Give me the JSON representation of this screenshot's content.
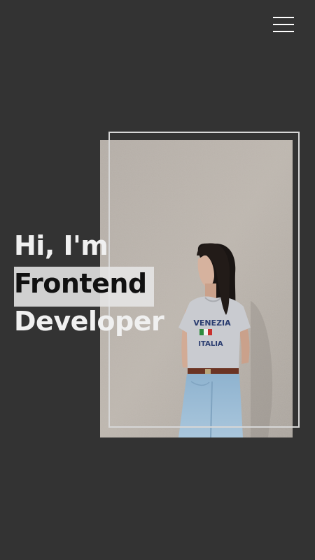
{
  "nav": {
    "menu_icon": "hamburger-menu-icon"
  },
  "hero": {
    "line1": "Hi, I'm",
    "line2": "Frontend",
    "line3": "Developer"
  },
  "photo": {
    "shirt_text_1": "VENEZIA",
    "shirt_text_2": "ITALIA"
  },
  "colors": {
    "background": "#333333",
    "text": "#f0f0f0",
    "highlight": "#e6e6e6",
    "frame": "#d6d6d6"
  }
}
